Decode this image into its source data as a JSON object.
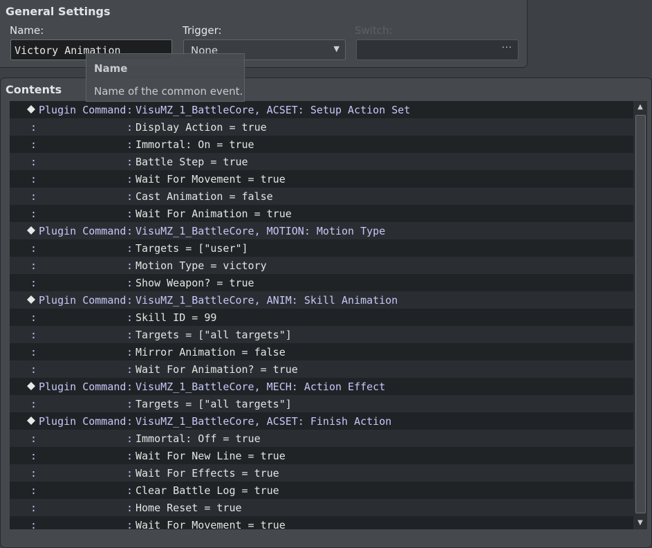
{
  "general": {
    "title": "General Settings",
    "name_label": "Name:",
    "name_value": "Victory Animation",
    "trigger_label": "Trigger:",
    "trigger_value": "None",
    "switch_label": "Switch:",
    "switch_button": "···"
  },
  "tooltip": {
    "title": "Name",
    "description": "Name of the common event."
  },
  "contents": {
    "title": "Contents",
    "rows": [
      {
        "type": "command",
        "label": "Plugin Command",
        "sep": ":",
        "text": "VisuMZ_1_BattleCore, ACSET: Setup Action Set"
      },
      {
        "type": "param",
        "cont": ":",
        "sep": ":",
        "text": "Display Action = true"
      },
      {
        "type": "param",
        "cont": ":",
        "sep": ":",
        "text": "Immortal: On = true"
      },
      {
        "type": "param",
        "cont": ":",
        "sep": ":",
        "text": "Battle Step = true"
      },
      {
        "type": "param",
        "cont": ":",
        "sep": ":",
        "text": "Wait For Movement = true"
      },
      {
        "type": "param",
        "cont": ":",
        "sep": ":",
        "text": "Cast Animation = false"
      },
      {
        "type": "param",
        "cont": ":",
        "sep": ":",
        "text": "Wait For Animation = true"
      },
      {
        "type": "command",
        "label": "Plugin Command",
        "sep": ":",
        "text": "VisuMZ_1_BattleCore, MOTION: Motion Type"
      },
      {
        "type": "param",
        "cont": ":",
        "sep": ":",
        "text": "Targets = [\"user\"]"
      },
      {
        "type": "param",
        "cont": ":",
        "sep": ":",
        "text": "Motion Type = victory"
      },
      {
        "type": "param",
        "cont": ":",
        "sep": ":",
        "text": "Show Weapon? = true"
      },
      {
        "type": "command",
        "label": "Plugin Command",
        "sep": ":",
        "text": "VisuMZ_1_BattleCore, ANIM: Skill Animation"
      },
      {
        "type": "param",
        "cont": ":",
        "sep": ":",
        "text": "Skill ID = 99"
      },
      {
        "type": "param",
        "cont": ":",
        "sep": ":",
        "text": "Targets = [\"all targets\"]"
      },
      {
        "type": "param",
        "cont": ":",
        "sep": ":",
        "text": "Mirror Animation = false"
      },
      {
        "type": "param",
        "cont": ":",
        "sep": ":",
        "text": "Wait For Animation? = true"
      },
      {
        "type": "command",
        "label": "Plugin Command",
        "sep": ":",
        "text": "VisuMZ_1_BattleCore, MECH: Action Effect"
      },
      {
        "type": "param",
        "cont": ":",
        "sep": ":",
        "text": "Targets = [\"all targets\"]"
      },
      {
        "type": "command",
        "label": "Plugin Command",
        "sep": ":",
        "text": "VisuMZ_1_BattleCore, ACSET: Finish Action"
      },
      {
        "type": "param",
        "cont": ":",
        "sep": ":",
        "text": "Immortal: Off = true"
      },
      {
        "type": "param",
        "cont": ":",
        "sep": ":",
        "text": "Wait For New Line = true"
      },
      {
        "type": "param",
        "cont": ":",
        "sep": ":",
        "text": "Wait For Effects = true"
      },
      {
        "type": "param",
        "cont": ":",
        "sep": ":",
        "text": "Clear Battle Log = true"
      },
      {
        "type": "param",
        "cont": ":",
        "sep": ":",
        "text": "Home Reset = true"
      },
      {
        "type": "param",
        "cont": ":",
        "sep": ":",
        "text": "Wait For Movement = true"
      }
    ]
  },
  "scrollbar": {
    "up_icon": "triangle-up-icon",
    "down_icon": "triangle-down-icon"
  },
  "colors": {
    "command_text": "#c7c7f8",
    "param_text": "#e4e4e4",
    "list_background": "#252a2d",
    "panel_background": "#45494e"
  }
}
